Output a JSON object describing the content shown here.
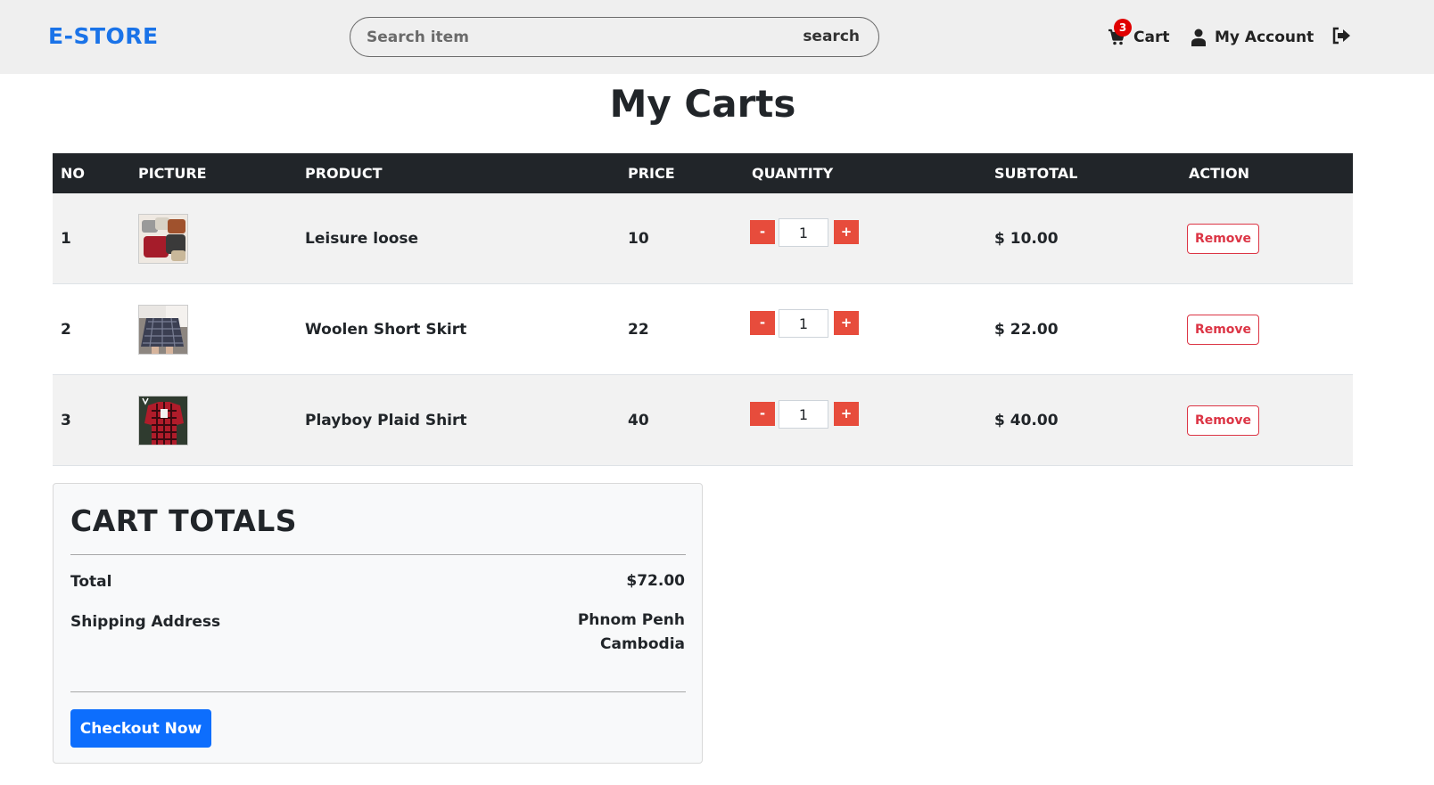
{
  "navbar": {
    "brand": "E-STORE",
    "search": {
      "placeholder": "Search item",
      "value": "",
      "button_label": "search"
    },
    "cart": {
      "label": "Cart",
      "count": "3"
    },
    "account": {
      "label": "My Account"
    },
    "icons": {
      "cart": "shopping-cart-icon",
      "account": "user-icon",
      "logout": "sign-out-icon"
    }
  },
  "page": {
    "title": "My Carts"
  },
  "table": {
    "headers": [
      "NO",
      "PICTURE",
      "PRODUCT",
      "PRICE",
      "QUANTITY",
      "SUBTOTAL",
      "ACTION"
    ],
    "rows": [
      {
        "no": "1",
        "product": "Leisure loose",
        "price": "10",
        "quantity": "1",
        "subtotal": "$ 10.00",
        "action": "Remove"
      },
      {
        "no": "2",
        "product": "Woolen Short Skirt",
        "price": "22",
        "quantity": "1",
        "subtotal": "$ 22.00",
        "action": "Remove"
      },
      {
        "no": "3",
        "product": "Playboy Plaid Shirt",
        "price": "40",
        "quantity": "1",
        "subtotal": "$ 40.00",
        "action": "Remove"
      }
    ],
    "qty_minus": "-",
    "qty_plus": "+"
  },
  "totals": {
    "title": "CART TOTALS",
    "total_label": "Total",
    "total_value": "$72.00",
    "shipping_label": "Shipping Address",
    "shipping_line1": "Phnom Penh",
    "shipping_line2": "Cambodia",
    "checkout_label": "Checkout Now"
  },
  "colors": {
    "brand": "#1a73e8",
    "header_bg": "#212529",
    "qty_button": "#e74c3c",
    "remove": "#dc3545",
    "checkout": "#0d6efd",
    "badge": "#e00000"
  }
}
